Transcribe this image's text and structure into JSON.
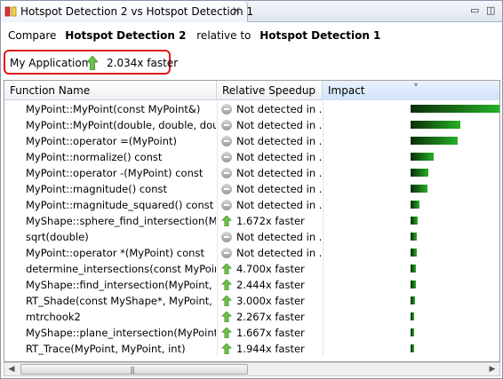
{
  "tab": {
    "title": "Hotspot Detection 2 vs Hotspot Detection 1",
    "close_icon": "close-icon",
    "icon": "compare-icon"
  },
  "window_controls": {
    "minimize_icon": "minimize-icon",
    "maximize_icon": "maximize-icon"
  },
  "compare": {
    "prefix": "Compare",
    "run_a": "Hotspot Detection 2",
    "middle": "relative to",
    "run_b": "Hotspot Detection 1"
  },
  "summary": {
    "app": "My Application",
    "speedup": "2.034x faster",
    "icon": "green-up-arrow-icon"
  },
  "table": {
    "columns": [
      "Function Name",
      "Relative Speedup",
      "Impact"
    ],
    "rows": [
      {
        "name": "MyPoint::MyPoint(const MyPoint&)",
        "speedup": "Not detected in ...",
        "status": "not-detected",
        "impact": 1.0
      },
      {
        "name": "MyPoint::MyPoint(double, double, double)",
        "speedup": "Not detected in ...",
        "status": "not-detected",
        "impact": 0.56
      },
      {
        "name": "MyPoint::operator =(MyPoint)",
        "speedup": "Not detected in ...",
        "status": "not-detected",
        "impact": 0.53
      },
      {
        "name": "MyPoint::normalize() const",
        "speedup": "Not detected in ...",
        "status": "not-detected",
        "impact": 0.26
      },
      {
        "name": "MyPoint::operator -(MyPoint) const",
        "speedup": "Not detected in ...",
        "status": "not-detected",
        "impact": 0.2
      },
      {
        "name": "MyPoint::magnitude() const",
        "speedup": "Not detected in ...",
        "status": "not-detected",
        "impact": 0.19
      },
      {
        "name": "MyPoint::magnitude_squared() const",
        "speedup": "Not detected in ...",
        "status": "not-detected",
        "impact": 0.1
      },
      {
        "name": "MyShape::sphere_find_intersection(MyPoint, MyPoint)",
        "speedup": "1.672x faster",
        "status": "faster",
        "impact": 0.08
      },
      {
        "name": "sqrt(double)",
        "speedup": "Not detected in ...",
        "status": "not-detected",
        "impact": 0.07
      },
      {
        "name": "MyPoint::operator *(MyPoint) const",
        "speedup": "Not detected in ...",
        "status": "not-detected",
        "impact": 0.07
      },
      {
        "name": "determine_intersections(const MyPoint*, int)",
        "speedup": "4.700x faster",
        "status": "faster",
        "impact": 0.06
      },
      {
        "name": "MyShape::find_intersection(MyPoint, MyPoint)",
        "speedup": "2.444x faster",
        "status": "faster",
        "impact": 0.06
      },
      {
        "name": "RT_Shade(const MyShape*, MyPoint, int)",
        "speedup": "3.000x faster",
        "status": "faster",
        "impact": 0.05
      },
      {
        "name": "mtrchook2",
        "speedup": "2.267x faster",
        "status": "faster",
        "impact": 0.04
      },
      {
        "name": "MyShape::plane_intersection(MyPoint, MyPoint)",
        "speedup": "1.667x faster",
        "status": "faster",
        "impact": 0.03
      },
      {
        "name": "RT_Trace(MyPoint, MyPoint, int)",
        "speedup": "1.944x faster",
        "status": "faster",
        "impact": 0.03
      }
    ]
  },
  "scrollbar": {
    "left_icon": "scroll-left-icon",
    "right_icon": "scroll-right-icon",
    "thumb_grip": "|||"
  }
}
